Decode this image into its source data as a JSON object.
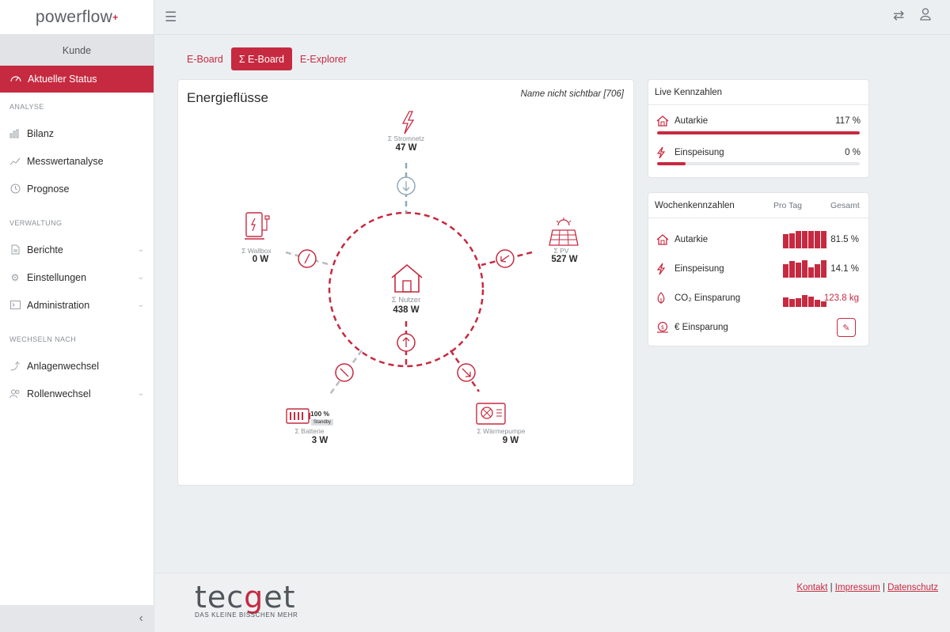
{
  "app": {
    "brand": "powerflow",
    "brand_mark": "+"
  },
  "sidebar": {
    "kunde": "Kunde",
    "active_item": "Aktueller Status",
    "sections": [
      {
        "label": "ANALYSE",
        "items": [
          "Bilanz",
          "Messwertanalyse",
          "Prognose"
        ]
      },
      {
        "label": "VERWALTUNG",
        "items": [
          "Berichte",
          "Einstellungen",
          "Administration"
        ]
      },
      {
        "label": "WECHSELN NACH",
        "items": [
          "Anlagenwechsel",
          "Rollenwechsel"
        ]
      }
    ],
    "collapse_icon": "chevron-left-icon"
  },
  "tabs": [
    {
      "label": "E-Board",
      "active": false
    },
    {
      "label": "Σ E-Board",
      "active": true
    },
    {
      "label": "E-Explorer",
      "active": false
    }
  ],
  "energy": {
    "title": "Energieflüsse",
    "meta": "Name nicht sichtbar [706]",
    "nodes": {
      "grid": {
        "label": "Σ Stromnetz",
        "value": "47 W"
      },
      "wallbox": {
        "label": "Σ Wallbox",
        "value": "0 W"
      },
      "pv": {
        "label": "Σ PV",
        "value": "527 W"
      },
      "user": {
        "label": "Σ Nutzer",
        "value": "438 W"
      },
      "battery": {
        "label": "Σ Batterie",
        "value": "3 W",
        "soc": "100 %",
        "state": "Standby"
      },
      "heatpump": {
        "label": "Σ Wärmepumpe",
        "value": "9 W"
      }
    }
  },
  "live": {
    "title": "Live Kennzahlen",
    "rows": [
      {
        "label": "Autarkie",
        "value": "117 %",
        "fill": 1.0
      },
      {
        "label": "Einspeisung",
        "value": "0 %",
        "fill": 0.14
      }
    ]
  },
  "week": {
    "title": "Wochenkennzahlen",
    "col_day": "Pro Tag",
    "col_total": "Gesamt",
    "rows": [
      {
        "label": "Autarkie",
        "value": "81.5 %",
        "bars": [
          0.8,
          0.85,
          1,
          1,
          1,
          1,
          1
        ]
      },
      {
        "label": "Einspeisung",
        "value": "14.1 %",
        "bars": [
          0.75,
          0.95,
          0.85,
          1,
          0.6,
          0.75,
          1
        ]
      },
      {
        "label": "CO₂ Einsparung",
        "value": "123.8 kg",
        "bars": [
          0.55,
          0.45,
          0.5,
          0.7,
          0.6,
          0.4,
          0.3
        ]
      },
      {
        "label": "€ Einsparung",
        "value": ""
      }
    ]
  },
  "colors": {
    "accent": "#c62a40",
    "grid_flow": "#8fa9b8",
    "inactive_flow": "#b8bcc0"
  },
  "footer": {
    "logo_prefix": "tec",
    "logo_mark": "g",
    "logo_suffix": "et",
    "tagline": "DAS KLEINE BISSCHEN MEHR",
    "links": [
      "Kontakt",
      "Impressum",
      "Datenschutz"
    ],
    "separator": " | "
  }
}
